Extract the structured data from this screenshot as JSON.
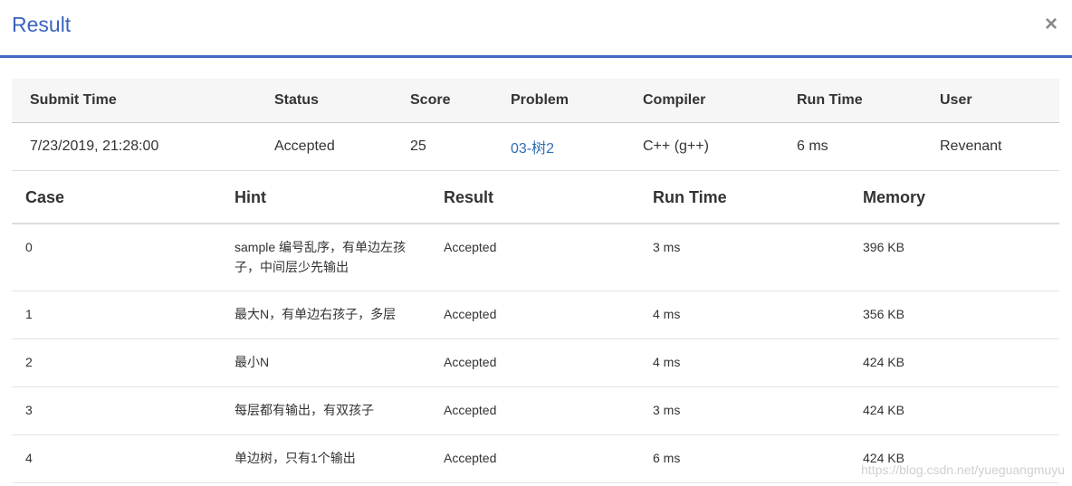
{
  "dialog": {
    "title": "Result",
    "close_label": "×"
  },
  "submission": {
    "headers": [
      "Submit Time",
      "Status",
      "Score",
      "Problem",
      "Compiler",
      "Run Time",
      "User"
    ],
    "row": {
      "submit_time": "7/23/2019, 21:28:00",
      "status": "Accepted",
      "score": "25",
      "problem": "03-树2",
      "compiler": "C++ (g++)",
      "run_time": "6 ms",
      "user": "Revenant"
    }
  },
  "cases": {
    "headers": [
      "Case",
      "Hint",
      "Result",
      "Run Time",
      "Memory"
    ],
    "rows": [
      {
        "case": "0",
        "hint": "sample 编号乱序，有单边左孩子，中间层少先输出",
        "result": "Accepted",
        "run_time": "3 ms",
        "memory": "396 KB"
      },
      {
        "case": "1",
        "hint": "最大N，有单边右孩子，多层",
        "result": "Accepted",
        "run_time": "4 ms",
        "memory": "356 KB"
      },
      {
        "case": "2",
        "hint": "最小N",
        "result": "Accepted",
        "run_time": "4 ms",
        "memory": "424 KB"
      },
      {
        "case": "3",
        "hint": "每层都有输出，有双孩子",
        "result": "Accepted",
        "run_time": "3 ms",
        "memory": "424 KB"
      },
      {
        "case": "4",
        "hint": "单边树，只有1个输出",
        "result": "Accepted",
        "run_time": "6 ms",
        "memory": "424 KB"
      }
    ]
  },
  "watermark": "https://blog.csdn.net/yueguangmuyu",
  "colors": {
    "accent": "#3a63c0",
    "accepted": "#e8433a",
    "link": "#2f6db7"
  }
}
